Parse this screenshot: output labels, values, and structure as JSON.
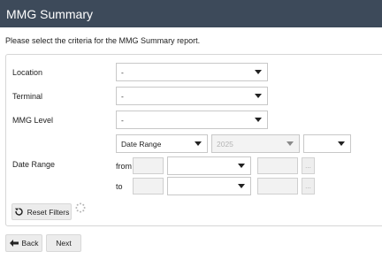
{
  "title": "MMG Summary",
  "intro": "Please select the criteria for the MMG Summary report.",
  "fields": {
    "location": {
      "label": "Location",
      "value": "-"
    },
    "terminal": {
      "label": "Terminal",
      "value": "-"
    },
    "mmg_level": {
      "label": "MMG Level",
      "value": "-"
    }
  },
  "date_range": {
    "label": "Date Range",
    "type_value": "Date Range",
    "year_value": "2025",
    "period_value": "",
    "from_label": "from",
    "to_label": "to",
    "dots": "..."
  },
  "buttons": {
    "reset": "Reset Filters",
    "back": "Back",
    "next": "Next"
  }
}
